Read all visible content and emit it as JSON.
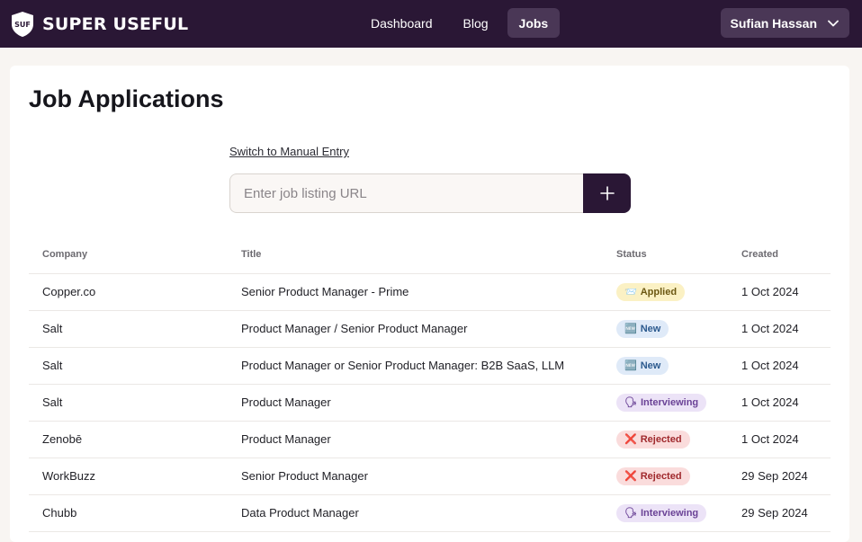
{
  "brand": {
    "badge": "SUF",
    "name": "SUPER USEFUL"
  },
  "nav": {
    "links": [
      "Dashboard",
      "Blog",
      "Jobs"
    ],
    "active": "Jobs"
  },
  "user": {
    "name": "Sufian Hassan",
    "icon": "chevron-down-icon"
  },
  "page": {
    "title": "Job Applications",
    "switch_link": "Switch to Manual Entry",
    "url_placeholder": "Enter job listing URL",
    "add_icon": "plus-icon"
  },
  "table": {
    "headers": [
      "Company",
      "Title",
      "Status",
      "Created"
    ],
    "rows": [
      {
        "company": "Copper.co",
        "title": "Senior Product Manager - Prime",
        "status": "Applied",
        "status_icon": "📨",
        "status_kind": "applied",
        "created": "1 Oct 2024"
      },
      {
        "company": "Salt",
        "title": "Product Manager / Senior Product Manager",
        "status": "New",
        "status_icon": "🆕",
        "status_kind": "new",
        "created": "1 Oct 2024"
      },
      {
        "company": "Salt",
        "title": "Product Manager or Senior Product Manager: B2B SaaS, LLM",
        "status": "New",
        "status_icon": "🆕",
        "status_kind": "new",
        "created": "1 Oct 2024"
      },
      {
        "company": "Salt",
        "title": "Product Manager",
        "status": "Interviewing",
        "status_icon": "🗣",
        "status_kind": "interviewing",
        "created": "1 Oct 2024"
      },
      {
        "company": "Zenobē",
        "title": "Product Manager",
        "status": "Rejected",
        "status_icon": "❌",
        "status_kind": "rejected",
        "created": "1 Oct 2024"
      },
      {
        "company": "WorkBuzz",
        "title": "Senior Product Manager",
        "status": "Rejected",
        "status_icon": "❌",
        "status_kind": "rejected",
        "created": "29 Sep 2024"
      },
      {
        "company": "Chubb",
        "title": "Data Product Manager",
        "status": "Interviewing",
        "status_icon": "🗣",
        "status_kind": "interviewing",
        "created": "29 Sep 2024"
      }
    ]
  },
  "colors": {
    "nav_bg": "#2a1735",
    "nav_active": "#4a3756",
    "applied": "#fbf1c4",
    "new": "#dfeaf8",
    "interviewing": "#ece3f7",
    "rejected": "#fadcdc"
  }
}
